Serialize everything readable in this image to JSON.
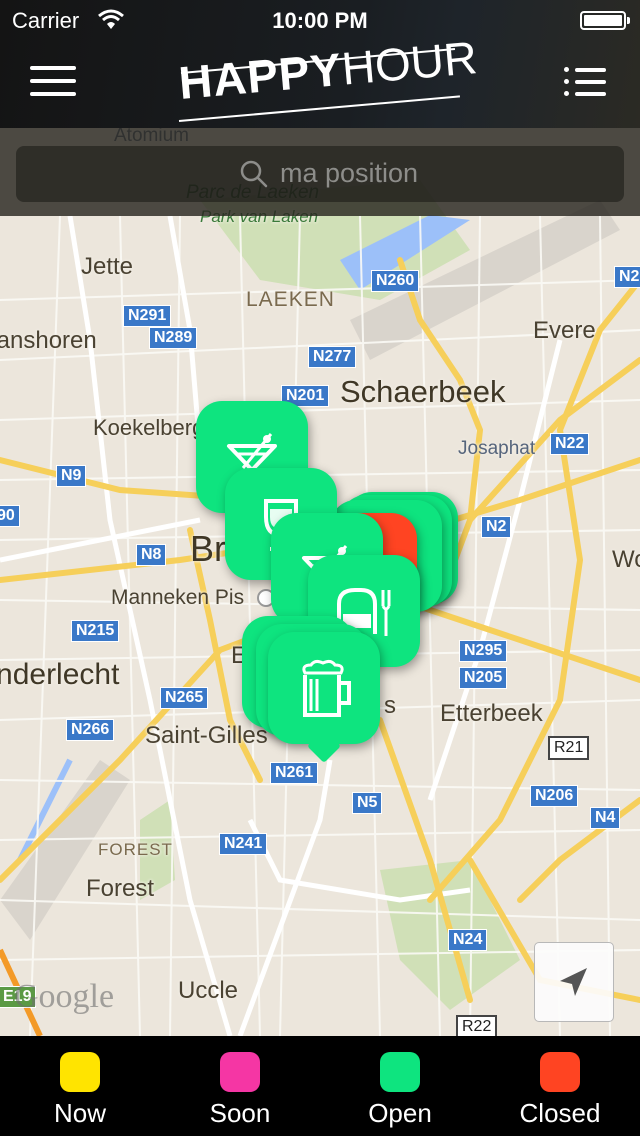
{
  "status_bar": {
    "carrier": "Carrier",
    "time": "10:00 PM",
    "battery_level": 1.0
  },
  "header": {
    "logo_bold": "HAPPY",
    "logo_light": "HOUR",
    "menu_icon": "hamburger-icon",
    "list_icon": "list-icon"
  },
  "search": {
    "placeholder": "ma position",
    "icon": "search-icon"
  },
  "map": {
    "places": [
      {
        "name": "Atomium",
        "kind": "poi"
      },
      {
        "name": "Parc de Laeken",
        "kind": "park"
      },
      {
        "name": "Park van Laken",
        "kind": "park"
      },
      {
        "name": "Jette",
        "kind": "town"
      },
      {
        "name": "LAEKEN",
        "kind": "district"
      },
      {
        "name": "Evere",
        "kind": "town"
      },
      {
        "name": "Schaerbeek",
        "kind": "town"
      },
      {
        "name": "Ganshoren",
        "kind": "town"
      },
      {
        "name": "Koekelberg",
        "kind": "town"
      },
      {
        "name": "Josaphat",
        "kind": "poi"
      },
      {
        "name": "Br",
        "kind": "city"
      },
      {
        "name": "Manneken Pis",
        "kind": "poi"
      },
      {
        "name": "Wo",
        "kind": "town"
      },
      {
        "name": "Anderlecht",
        "kind": "town"
      },
      {
        "name": "Etterbeek",
        "kind": "town"
      },
      {
        "name": "Saint-Gilles",
        "kind": "town"
      },
      {
        "name": "FOREST",
        "kind": "district"
      },
      {
        "name": "Forest",
        "kind": "town"
      },
      {
        "name": "Uccle",
        "kind": "town"
      },
      {
        "name": "E",
        "kind": "town"
      },
      {
        "name": "s",
        "kind": "town"
      }
    ],
    "road_shields": [
      "N260",
      "N291",
      "N289",
      "N277",
      "N201",
      "N22",
      "N9",
      "N2",
      "N8",
      "N215",
      "N295",
      "N205",
      "N265",
      "N266",
      "R21",
      "N261",
      "N206",
      "N5",
      "N4",
      "N241",
      "N24",
      "R22",
      "E19",
      "90",
      "N2"
    ],
    "attribution": "Google",
    "markers": [
      {
        "icon": "cocktail-icon",
        "status": "Open"
      },
      {
        "icon": "wine-glass-icon",
        "status": "Open"
      },
      {
        "icon": "cluster",
        "status": "Open"
      },
      {
        "icon": "cluster",
        "status": "Closed"
      },
      {
        "icon": "cocktail-icon",
        "status": "Open"
      },
      {
        "icon": "restaurant-icon",
        "status": "Open"
      },
      {
        "icon": "beer-mug-icon",
        "status": "Open"
      }
    ]
  },
  "locate_button": {
    "icon": "location-arrow-icon"
  },
  "legend": [
    {
      "label": "Now",
      "color": "#ffe400"
    },
    {
      "label": "Soon",
      "color": "#f536a4"
    },
    {
      "label": "Open",
      "color": "#0ee47f"
    },
    {
      "label": "Closed",
      "color": "#ff4422"
    }
  ]
}
